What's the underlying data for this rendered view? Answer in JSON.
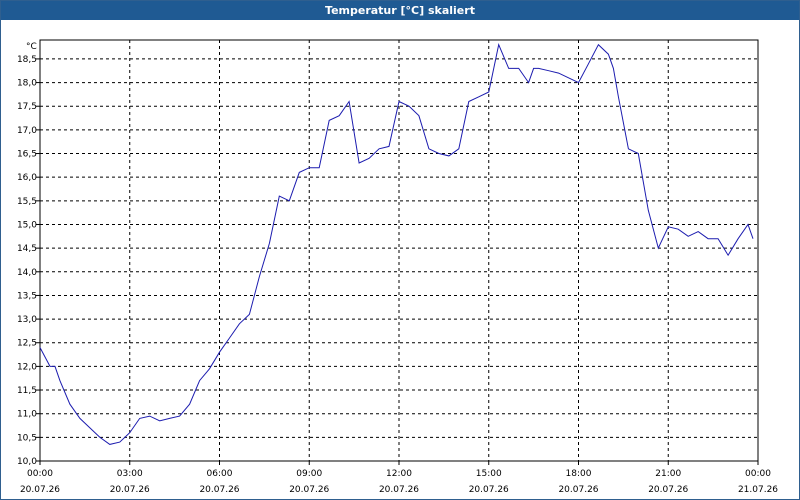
{
  "window": {
    "title": "Temperatur [°C] skaliert"
  },
  "colors": {
    "titlebar": "#1f5a93",
    "line": "#1c1caf",
    "grid": "#000000"
  },
  "chart_data": {
    "type": "line",
    "title": "Temperatur [°C] skaliert",
    "ylabel": "°C",
    "ylim": [
      10.0,
      18.9
    ],
    "xlim": [
      "20.07.26 00:00",
      "21.07.26 00:00"
    ],
    "grid": true,
    "y_ticks": [
      "10,0",
      "10,5",
      "11,0",
      "11,5",
      "12,0",
      "12,5",
      "13,0",
      "13,5",
      "14,0",
      "14,5",
      "15,0",
      "15,5",
      "16,0",
      "16,5",
      "17,0",
      "17,5",
      "18,0",
      "18,5"
    ],
    "x_ticks": [
      {
        "time": "00:00",
        "date": "20.07.26"
      },
      {
        "time": "03:00",
        "date": "20.07.26"
      },
      {
        "time": "06:00",
        "date": "20.07.26"
      },
      {
        "time": "09:00",
        "date": "20.07.26"
      },
      {
        "time": "12:00",
        "date": "20.07.26"
      },
      {
        "time": "15:00",
        "date": "20.07.26"
      },
      {
        "time": "18:00",
        "date": "20.07.26"
      },
      {
        "time": "21:00",
        "date": "20.07.26"
      },
      {
        "time": "00:00",
        "date": "21.07.26"
      }
    ],
    "series": [
      {
        "x": [
          "00:00",
          "00:20",
          "00:30",
          "00:40",
          "01:00",
          "01:20",
          "01:40",
          "02:00",
          "02:20",
          "02:40",
          "03:00",
          "03:20",
          "03:40",
          "04:00",
          "04:20",
          "04:40",
          "05:00",
          "05:20",
          "05:40",
          "06:00",
          "06:20",
          "06:40",
          "07:00",
          "07:20",
          "07:40",
          "08:00",
          "08:20",
          "08:40",
          "09:00",
          "09:20",
          "09:40",
          "10:00",
          "10:20",
          "10:40",
          "11:00",
          "11:20",
          "11:40",
          "12:00",
          "12:20",
          "12:40",
          "13:00",
          "13:20",
          "13:40",
          "14:00",
          "14:20",
          "14:40",
          "15:00",
          "15:20",
          "15:40",
          "16:00",
          "16:20",
          "16:30",
          "16:40",
          "17:00",
          "17:20",
          "17:40",
          "18:00",
          "18:20",
          "18:40",
          "19:00",
          "19:10",
          "19:20",
          "19:40",
          "20:00",
          "20:20",
          "20:40",
          "21:00",
          "21:20",
          "21:40",
          "22:00",
          "22:20",
          "22:40",
          "23:00",
          "23:20",
          "23:40",
          "23:50"
        ],
        "y": [
          12.4,
          12.0,
          12.0,
          11.7,
          11.2,
          10.9,
          10.7,
          10.5,
          10.35,
          10.4,
          10.6,
          10.9,
          10.95,
          10.85,
          10.9,
          10.95,
          11.2,
          11.7,
          11.95,
          12.3,
          12.6,
          12.9,
          13.1,
          13.9,
          14.6,
          15.6,
          15.5,
          16.1,
          16.2,
          16.2,
          17.2,
          17.3,
          17.6,
          16.3,
          16.4,
          16.6,
          16.65,
          17.6,
          17.5,
          17.3,
          16.6,
          16.5,
          16.45,
          16.6,
          17.6,
          17.7,
          17.8,
          18.8,
          18.3,
          18.3,
          18.0,
          18.3,
          18.3,
          18.25,
          18.2,
          18.1,
          18.0,
          18.4,
          18.8,
          18.6,
          18.3,
          17.7,
          16.6,
          16.5,
          15.3,
          14.5,
          14.95,
          14.9,
          14.75,
          14.85,
          14.7,
          14.7,
          14.35,
          14.7,
          15.0,
          14.7
        ]
      }
    ]
  }
}
